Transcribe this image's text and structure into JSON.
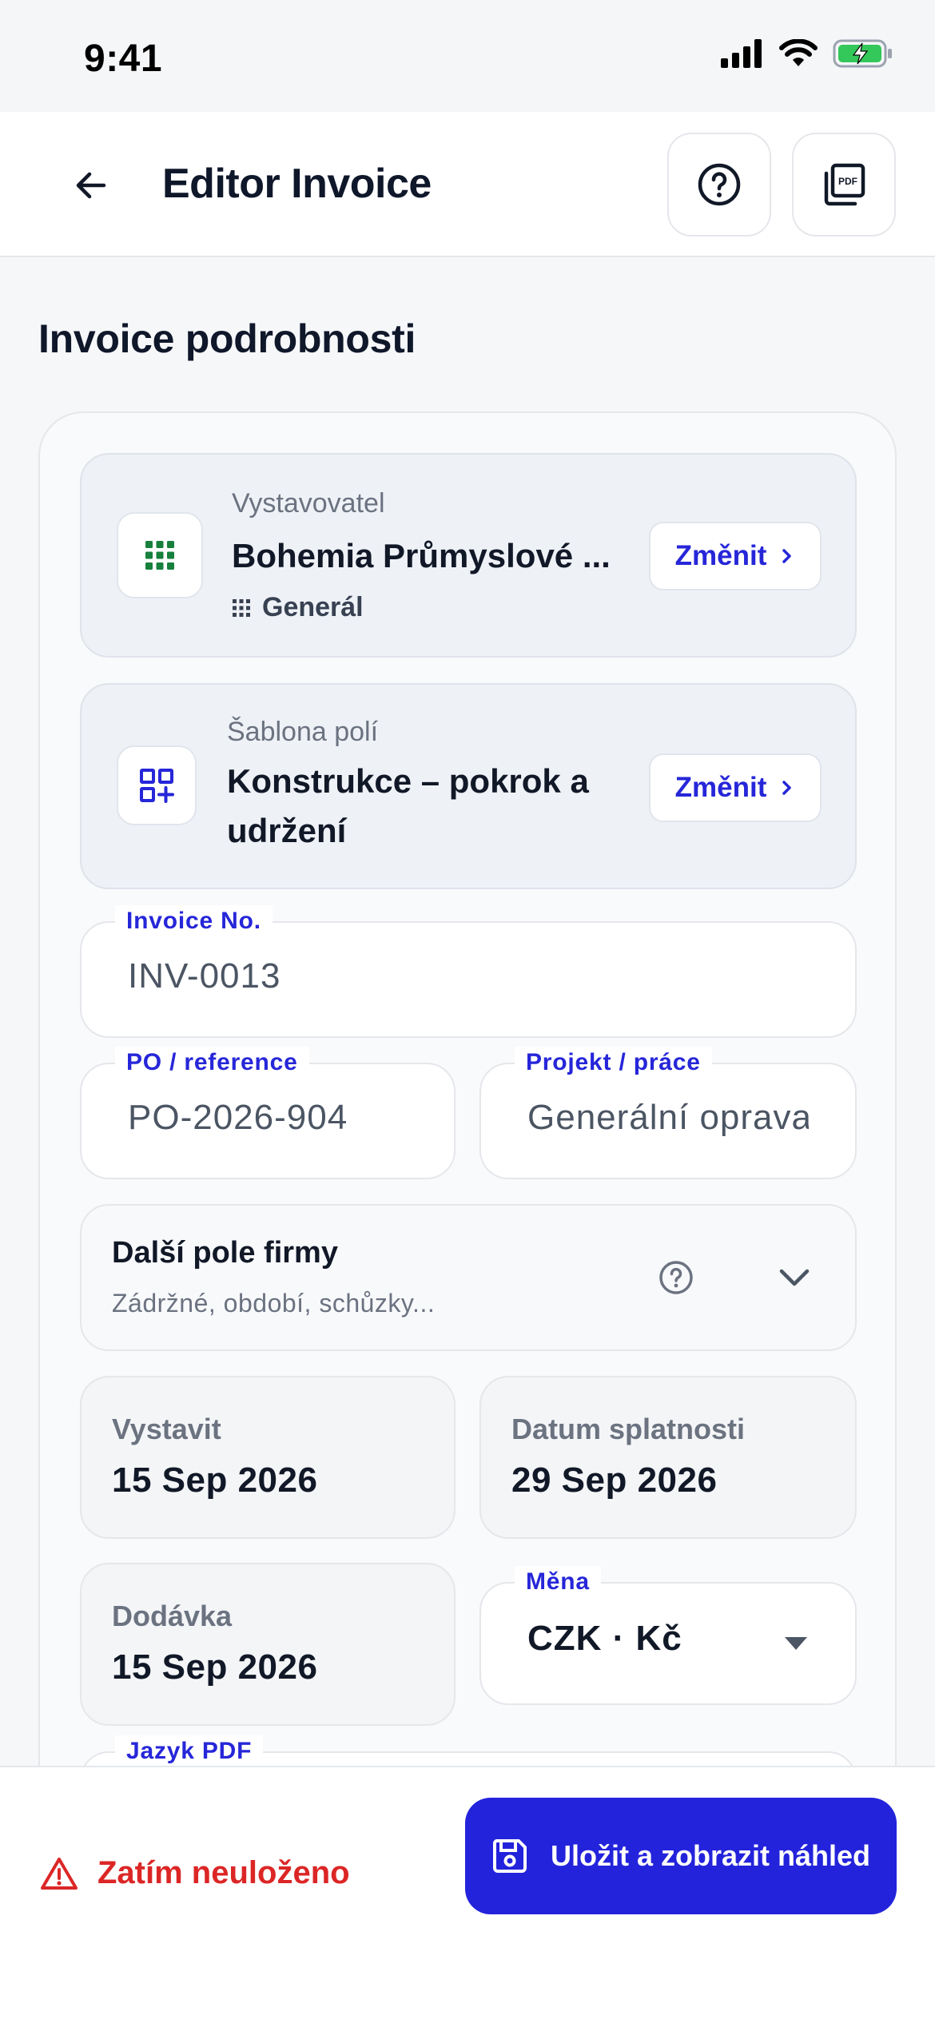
{
  "status_bar": {
    "time": "9:41"
  },
  "header": {
    "title": "Editor Invoice"
  },
  "section_title": "Invoice podrobnosti",
  "issuer": {
    "label": "Vystavovatel",
    "value": "Bohemia Průmyslové ...",
    "sub": "Generál",
    "change": "Změnit"
  },
  "template": {
    "label": "Šablona polí",
    "value_line1": "Konstrukce – pokrok a",
    "value_line2": "udržení",
    "change": "Změnit"
  },
  "invoice_no": {
    "label": "Invoice No.",
    "value": "INV-0013"
  },
  "po": {
    "label": "PO / reference",
    "value": "PO-2026-904"
  },
  "project": {
    "label": "Projekt / práce",
    "value": "Generální oprava"
  },
  "more_fields": {
    "title": "Další pole firmy",
    "subtitle": "Zádržné, období, schůzky..."
  },
  "issue_date": {
    "label": "Vystavit",
    "value": "15 Sep 2026"
  },
  "due_date": {
    "label": "Datum splatnosti",
    "value": "29 Sep 2026"
  },
  "delivery_date": {
    "label": "Dodávka",
    "value": "15 Sep 2026"
  },
  "currency": {
    "label": "Měna",
    "value": "CZK · Kč"
  },
  "pdf_language": {
    "label": "Jazyk PDF"
  },
  "footer": {
    "unsaved": "Zatím neuloženo",
    "save": "Uložit a zobrazit náhled"
  },
  "colors": {
    "accent": "#2323dc",
    "danger": "#dc2626",
    "green": "#16803c"
  }
}
